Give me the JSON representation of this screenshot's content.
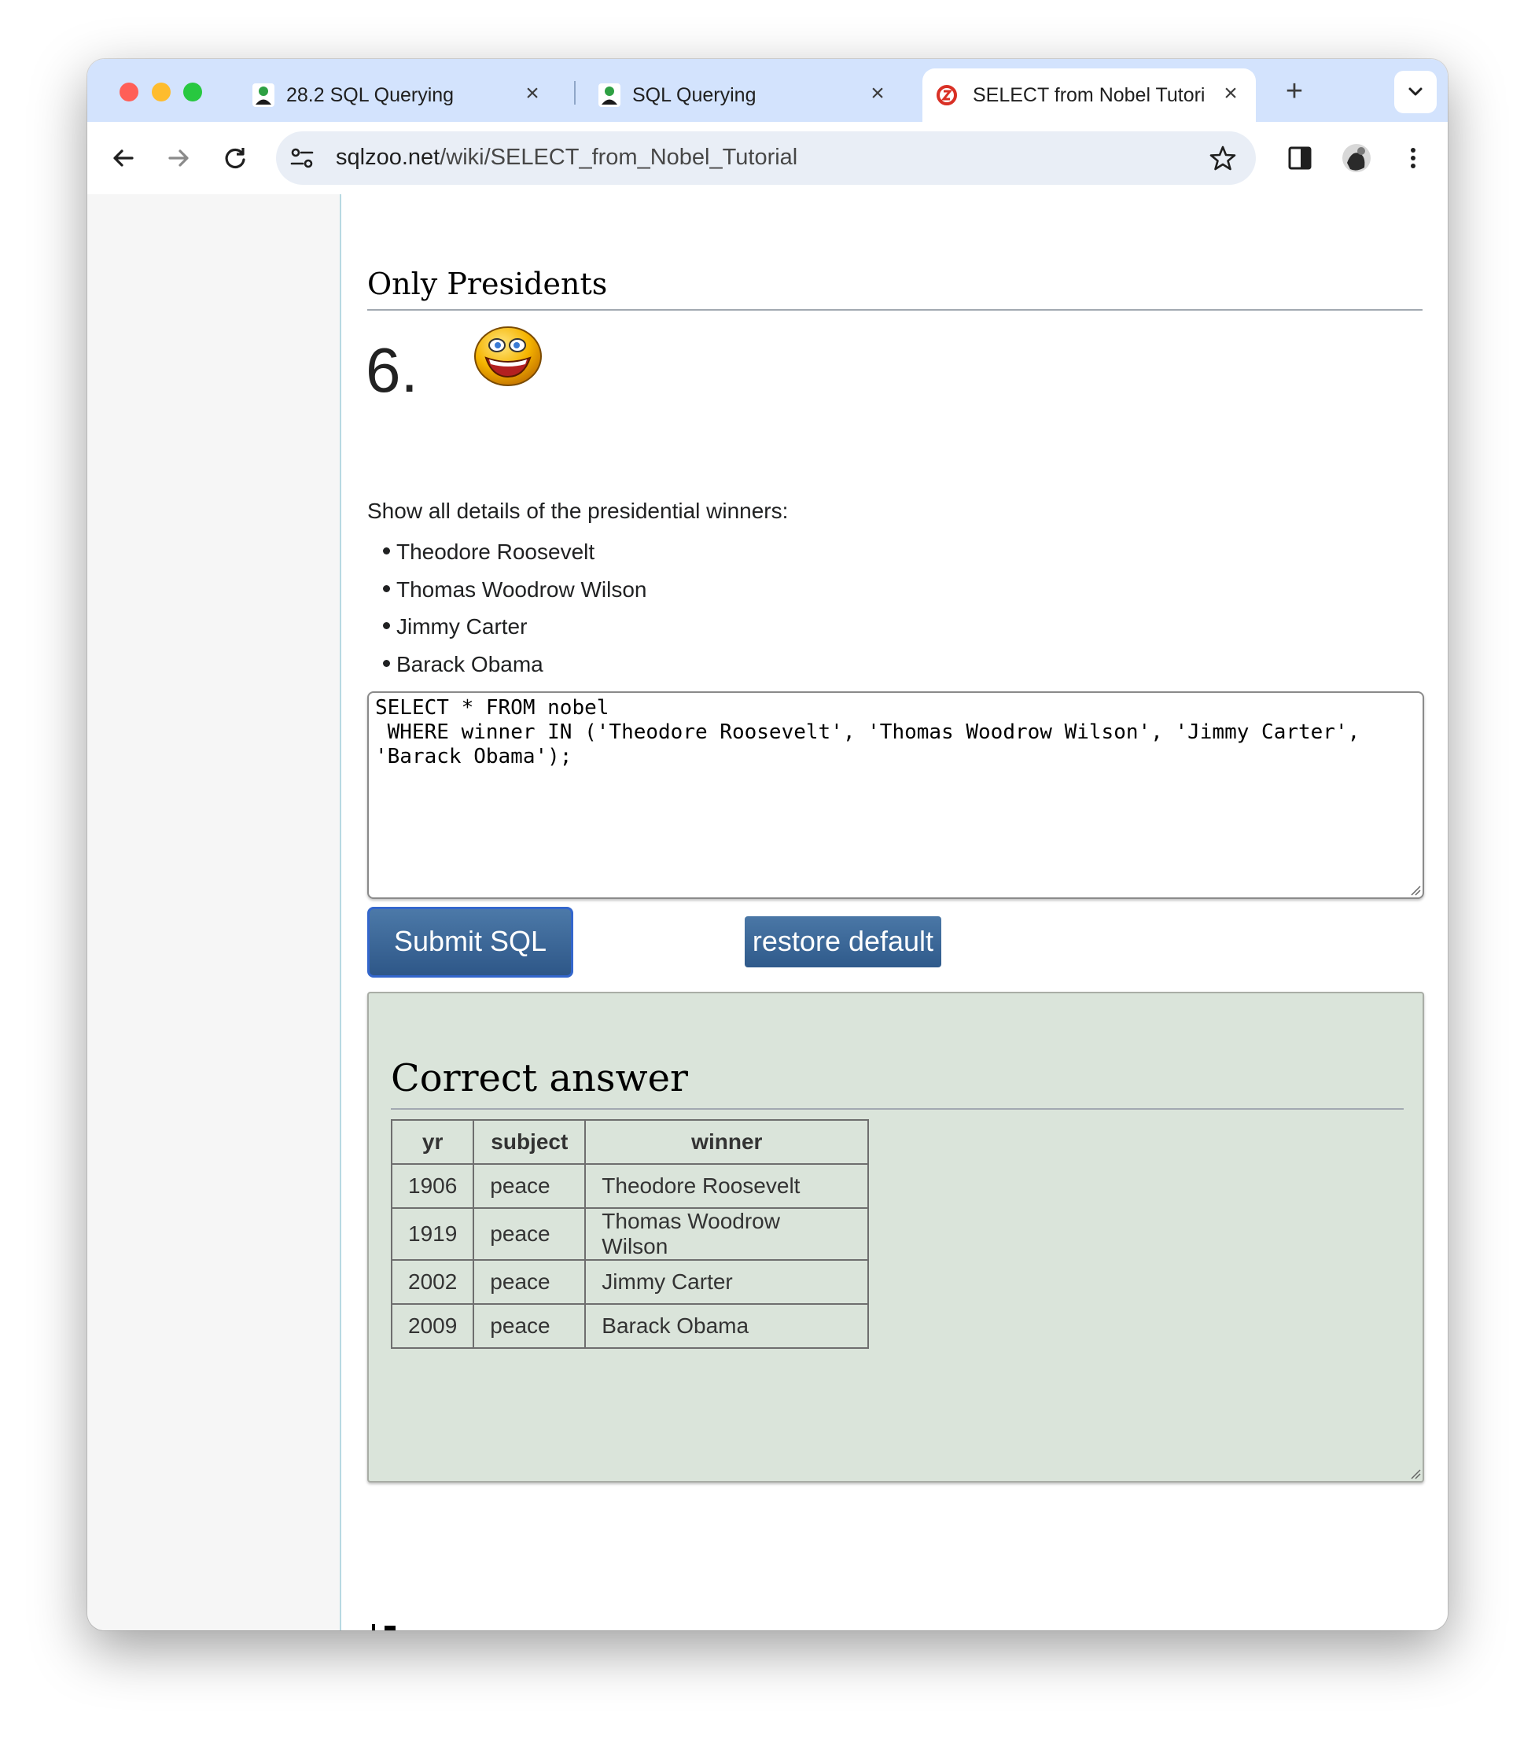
{
  "tabs": [
    {
      "label": "28.2 SQL Querying",
      "favicon": "person-green-icon",
      "active": false
    },
    {
      "label": "SQL Querying",
      "favicon": "person-green-icon",
      "active": false
    },
    {
      "label": "SELECT from Nobel Tutori",
      "favicon": "sqlzoo-icon",
      "active": true
    }
  ],
  "address_bar": {
    "host": "sqlzoo.net",
    "path": "/wiki/SELECT_from_Nobel_Tutorial"
  },
  "page": {
    "section_title": "Only Presidents",
    "question_number": "6.",
    "question_text": "Show all details of the presidential winners:",
    "names": [
      "Theodore Roosevelt",
      "Thomas Woodrow Wilson",
      "Jimmy Carter",
      "Barack Obama"
    ],
    "sql_query": "SELECT * FROM nobel\n WHERE winner IN ('Theodore Roosevelt', 'Thomas Woodrow Wilson', 'Jimmy Carter', 'Barack Obama');",
    "submit_label": "Submit SQL",
    "restore_label": "restore default",
    "answer_title": "Correct answer"
  },
  "result_table": {
    "headers": [
      "yr",
      "subject",
      "winner"
    ],
    "rows": [
      [
        "1906",
        "peace",
        "Theodore Roosevelt"
      ],
      [
        "1919",
        "peace",
        "Thomas Woodrow Wilson"
      ],
      [
        "2002",
        "peace",
        "Jimmy Carter"
      ],
      [
        "2009",
        "peace",
        "Barack Obama"
      ]
    ]
  },
  "colors": {
    "tabstrip": "#d3e3fd",
    "button": "#2e5788",
    "answer_panel": "#dae4da",
    "sidebar": "#f6f6f6"
  }
}
